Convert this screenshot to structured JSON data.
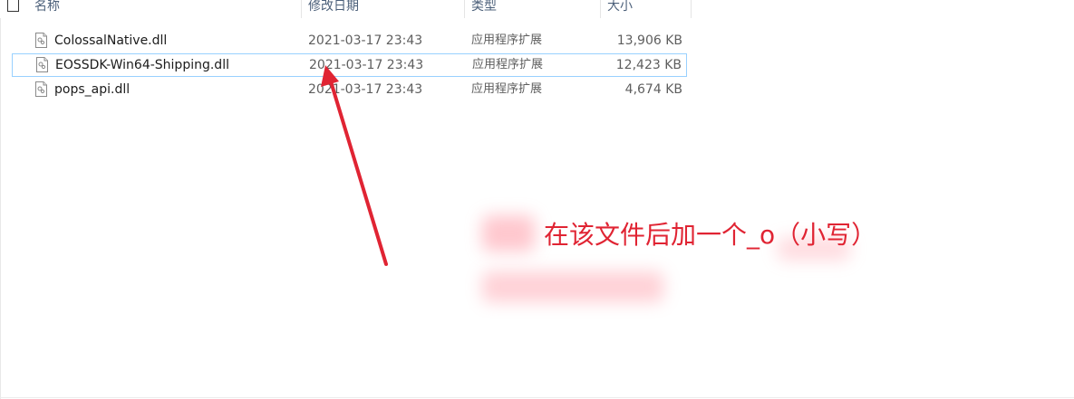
{
  "columns": {
    "name": "名称",
    "date": "修改日期",
    "type": "类型",
    "size": "大小"
  },
  "files": [
    {
      "name": "ColossalNative.dll",
      "date": "2021-03-17 23:43",
      "type": "应用程序扩展",
      "size": "13,906 KB",
      "icon": "dll-file-icon",
      "selected": false
    },
    {
      "name": "EOSSDK-Win64-Shipping.dll",
      "date": "2021-03-17 23:43",
      "type": "应用程序扩展",
      "size": "12,423 KB",
      "icon": "dll-file-icon",
      "selected": true
    },
    {
      "name": "pops_api.dll",
      "date": "2021-03-17 23:43",
      "type": "应用程序扩展",
      "size": "4,674 KB",
      "icon": "dll-file-icon",
      "selected": false
    }
  ],
  "annotation": {
    "text": "在该文件后加一个_o（小写）",
    "color": "#e02433"
  },
  "colors": {
    "header_text": "#4c607a",
    "selection_border": "#99d1ff",
    "arrow": "#e02433"
  }
}
